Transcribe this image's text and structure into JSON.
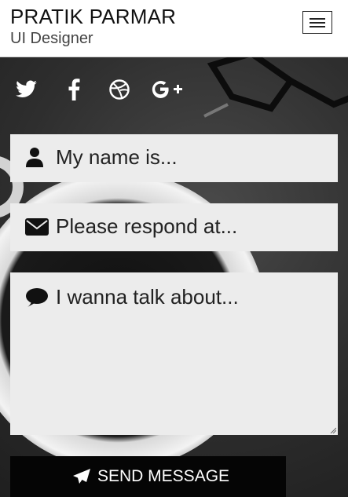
{
  "header": {
    "name": "PRATIK PARMAR",
    "role": "UI Designer",
    "menu_icon": "hamburger-menu-icon"
  },
  "social": [
    {
      "icon": "twitter-icon"
    },
    {
      "icon": "facebook-icon"
    },
    {
      "icon": "dribbble-icon"
    },
    {
      "icon": "google-plus-icon"
    }
  ],
  "form": {
    "name_placeholder": "My name is...",
    "email_placeholder": "Please respond at...",
    "message_placeholder": "I wanna talk about...",
    "send_label": "SEND MESSAGE"
  },
  "colors": {
    "header_bg": "#ffffff",
    "field_bg": "#ececec",
    "button_bg": "#050505"
  }
}
